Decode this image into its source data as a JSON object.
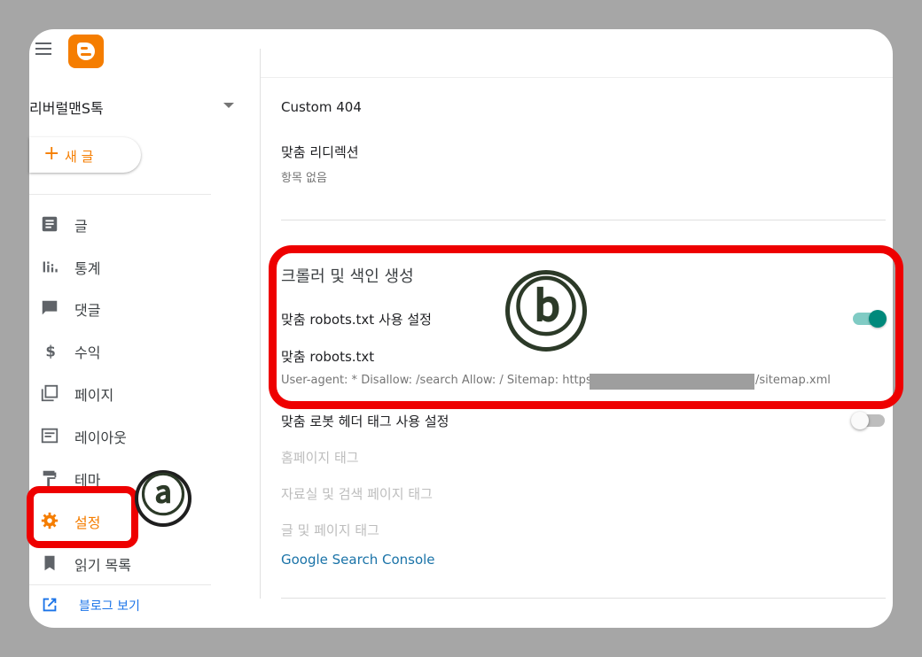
{
  "sidebar": {
    "blog_name": "리버럴맨S톡",
    "new_post_icon": "+",
    "new_post_label": "새 글",
    "items": [
      {
        "label": "글",
        "icon": "posts-icon"
      },
      {
        "label": "통계",
        "icon": "stats-icon"
      },
      {
        "label": "댓글",
        "icon": "comments-icon"
      },
      {
        "label": "수익",
        "icon": "earnings-icon"
      },
      {
        "label": "페이지",
        "icon": "pages-icon"
      },
      {
        "label": "레이아웃",
        "icon": "layout-icon"
      },
      {
        "label": "테마",
        "icon": "theme-icon"
      },
      {
        "label": "설정",
        "icon": "gear-icon",
        "active": true
      },
      {
        "label": "읽기 목록",
        "icon": "bookmark-icon"
      }
    ],
    "view_blog": "블로그 보기"
  },
  "annotations": {
    "a": "ⓐ",
    "b": "ⓑ"
  },
  "settings": {
    "custom_404": "Custom 404",
    "custom_redirects": "맞춤 리디렉션",
    "no_items": "항목 없음",
    "crawler_section": "크롤러 및 색인 생성",
    "enable_custom_robots": "맞춤 robots.txt 사용 설정",
    "enable_custom_robots_on": true,
    "custom_robots": "맞춤 robots.txt",
    "robots_prefix": "User-agent: * Disallow: /search Allow: / Sitemap: https://",
    "robots_suffix": "/sitemap.xml",
    "enable_header_tags": "맞춤 로봇 헤더 태그 사용 설정",
    "enable_header_tags_on": false,
    "home_tags": "홈페이지 태그",
    "archive_tags": "자료실 및 검색 페이지 태그",
    "post_tags": "글 및 페이지 태그",
    "search_console": "Google Search Console"
  },
  "colors": {
    "accent": "#f57d00",
    "toggle_on": "#00897b",
    "link": "#1a73e8",
    "highlight": "#ee0000"
  }
}
